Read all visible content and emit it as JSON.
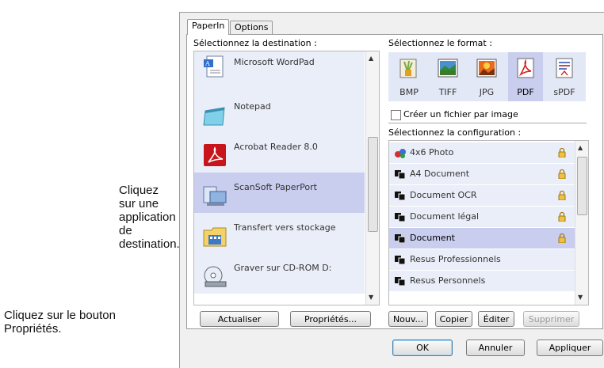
{
  "callouts": {
    "destination": "Cliquez sur une application de destination.",
    "properties": "Cliquez sur le bouton Propriétés."
  },
  "tabs": [
    "PaperIn",
    "Options"
  ],
  "destination": {
    "label": "Sélectionnez la destination :",
    "items": [
      {
        "label": "Microsoft WordPad",
        "icon": "wordpad-icon"
      },
      {
        "label": "Notepad",
        "icon": "notepad-icon"
      },
      {
        "label": "Acrobat Reader 8.0",
        "icon": "acrobat-icon"
      },
      {
        "label": "ScanSoft PaperPort",
        "icon": "paperport-icon",
        "selected": true
      },
      {
        "label": "Transfert vers stockage",
        "icon": "storage-folder-icon"
      },
      {
        "label": "Graver sur CD-ROM  D:",
        "icon": "cd-burn-icon"
      }
    ],
    "buttons": {
      "refresh": "Actualiser",
      "properties": "Propriétés..."
    }
  },
  "format": {
    "label": "Sélectionnez le format :",
    "items": [
      {
        "label": "BMP",
        "icon": "bmp-icon"
      },
      {
        "label": "TIFF",
        "icon": "tiff-icon"
      },
      {
        "label": "JPG",
        "icon": "jpg-icon"
      },
      {
        "label": "PDF",
        "icon": "pdf-icon",
        "selected": true
      },
      {
        "label": "sPDF",
        "icon": "spdf-icon"
      }
    ],
    "checkbox_label": "Créer un fichier par image",
    "checkbox_checked": false
  },
  "configuration": {
    "label": "Sélectionnez la configuration :",
    "items": [
      {
        "label": "4x6 Photo",
        "locked": true
      },
      {
        "label": "A4 Document",
        "locked": true
      },
      {
        "label": "Document OCR",
        "locked": true
      },
      {
        "label": "Document légal",
        "locked": true
      },
      {
        "label": "Document",
        "locked": true,
        "selected": true
      },
      {
        "label": "Resus Professionnels",
        "locked": false
      },
      {
        "label": "Resus Personnels",
        "locked": false
      }
    ],
    "buttons": {
      "new": "Nouv...",
      "copy": "Copier",
      "edit": "Éditer",
      "delete": "Supprimer"
    }
  },
  "dialog_buttons": {
    "ok": "OK",
    "cancel": "Annuler",
    "apply": "Appliquer"
  },
  "colors": {
    "selection": "#c9cdee",
    "list_bg": "#eaeef8",
    "pdf_red": "#d42020"
  }
}
